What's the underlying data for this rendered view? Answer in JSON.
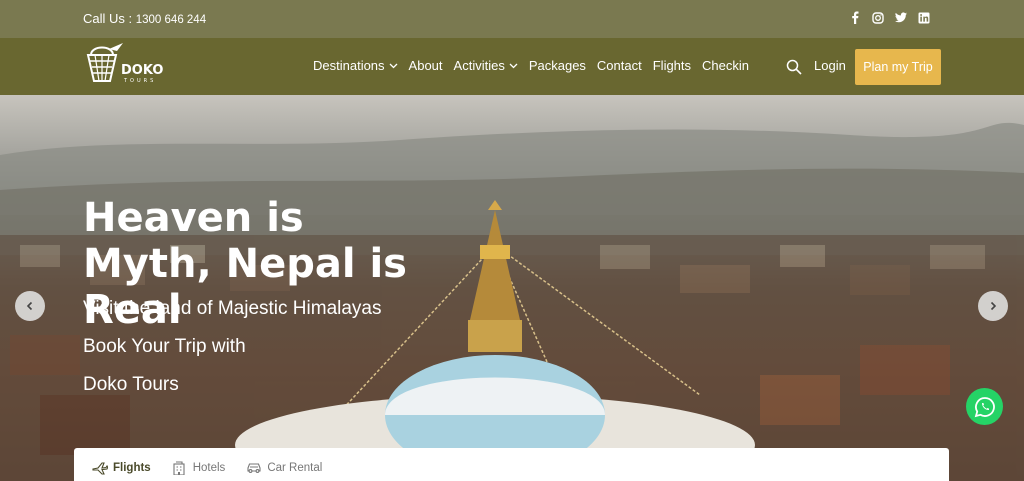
{
  "topbar": {
    "call_label": "Call Us :",
    "phone": "1300 646 244"
  },
  "social": [
    "facebook-icon",
    "instagram-icon",
    "twitter-icon",
    "linkedin-icon"
  ],
  "logo": {
    "name": "DOKO",
    "sub": "TOURS"
  },
  "nav": {
    "items": [
      {
        "label": "Destinations",
        "dropdown": true
      },
      {
        "label": "About",
        "dropdown": false
      },
      {
        "label": "Activities",
        "dropdown": true
      },
      {
        "label": "Packages",
        "dropdown": false
      },
      {
        "label": "Contact",
        "dropdown": false
      },
      {
        "label": "Flights",
        "dropdown": false
      },
      {
        "label": "Checkin",
        "dropdown": false
      }
    ],
    "login": "Login",
    "cta": "Plan my Trip"
  },
  "hero": {
    "title": "Heaven is Myth, Nepal is Real",
    "line1": "Visit the land of Majestic Himalayas",
    "line2": "Book Your Trip with",
    "line3": "Doko Tours"
  },
  "search_tabs": [
    {
      "label": "Flights",
      "icon": "plane-icon",
      "active": true
    },
    {
      "label": "Hotels",
      "icon": "building-icon",
      "active": false
    },
    {
      "label": "Car Rental",
      "icon": "car-icon",
      "active": false
    }
  ],
  "colors": {
    "topbar": "#7a7950",
    "navbar": "#696730",
    "cta": "#e7b74d",
    "whatsapp": "#25d366"
  }
}
